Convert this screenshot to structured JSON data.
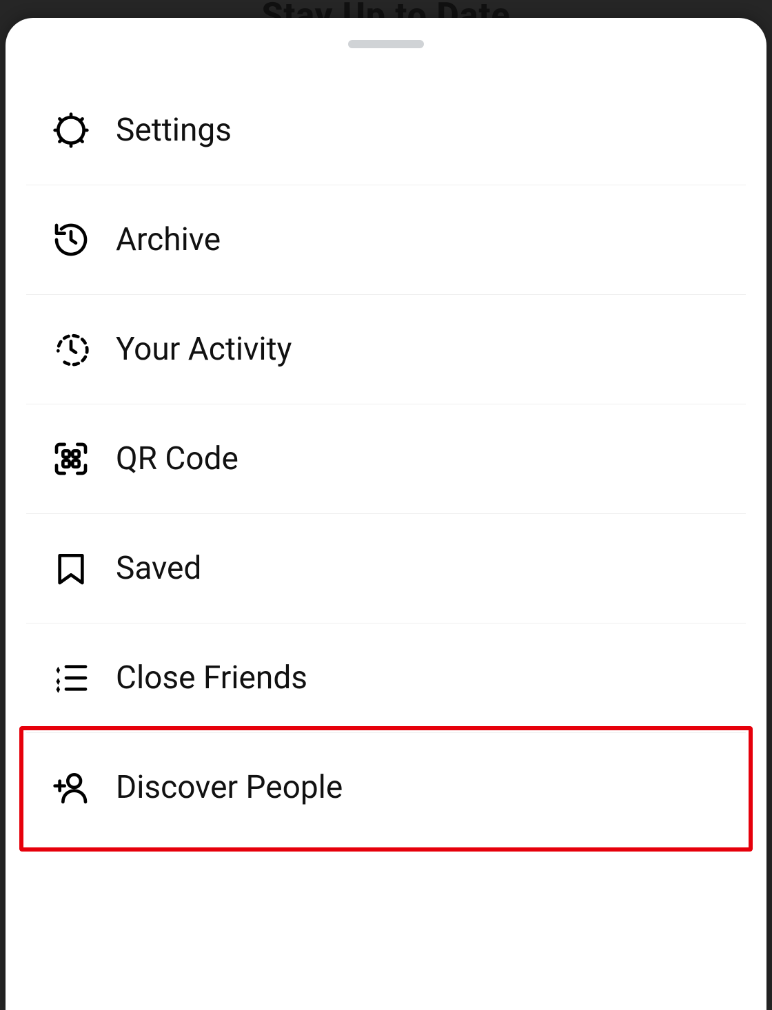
{
  "backdrop": {
    "title": "Stay Up to Date"
  },
  "menu": {
    "items": [
      {
        "label": "Settings",
        "icon": "gear-icon"
      },
      {
        "label": "Archive",
        "icon": "archive-icon"
      },
      {
        "label": "Your Activity",
        "icon": "activity-icon"
      },
      {
        "label": "QR Code",
        "icon": "qr-code-icon"
      },
      {
        "label": "Saved",
        "icon": "bookmark-icon"
      },
      {
        "label": "Close Friends",
        "icon": "close-friends-icon"
      },
      {
        "label": "Discover People",
        "icon": "add-person-icon"
      }
    ]
  },
  "highlight": {
    "index": 6
  }
}
